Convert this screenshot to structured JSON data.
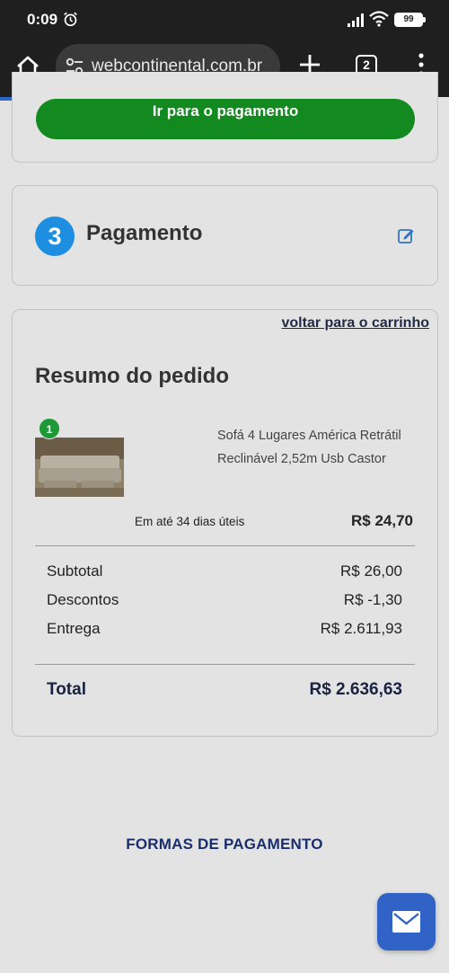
{
  "status_bar": {
    "time": "0:09",
    "battery": "99",
    "icons": [
      "alarm-icon",
      "signal-icon",
      "wifi-icon",
      "battery-icon"
    ]
  },
  "browser": {
    "url": "webcontinental.com.br",
    "tab_count": "2",
    "page_load_progress": 0.69
  },
  "checkout": {
    "pay_button_label": "Ir para o pagamento",
    "step_number": "3",
    "step_title": "Pagamento",
    "back_to_cart": "voltar para o carrinho",
    "summary_title": "Resumo do pedido",
    "product": {
      "quantity": "1",
      "name": "Sofá 4 Lugares América Retrátil Reclinável 2,52m Usb Castor",
      "delivery": "Em até 34 dias úteis",
      "price": "R$ 24,70"
    },
    "totals": {
      "subtotal_label": "Subtotal",
      "subtotal_value": "R$ 26,00",
      "discount_label": "Descontos",
      "discount_value": "R$ -1,30",
      "shipping_label": "Entrega",
      "shipping_value": "R$ 2.611,93",
      "total_label": "Total",
      "total_value": "R$ 2.636,63"
    },
    "payment_methods_link": "FORMAS DE PAGAMENTO"
  },
  "colors": {
    "accent_green": "#138a20",
    "step_blue": "#1e8fe0",
    "navy": "#1a2e6e",
    "fab_blue": "#3163c6"
  }
}
